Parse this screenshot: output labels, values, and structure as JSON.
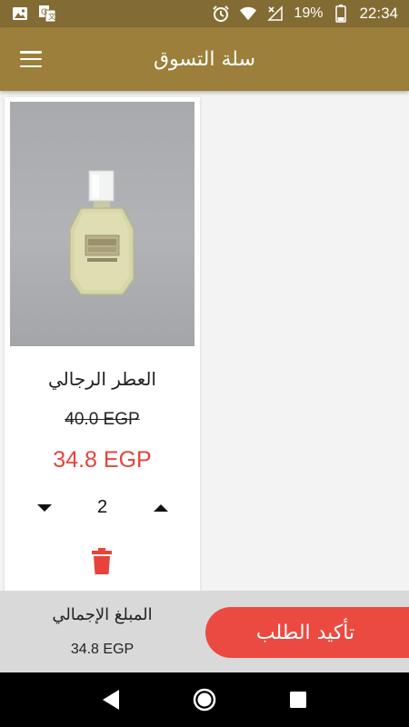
{
  "status_bar": {
    "battery_percent": "19%",
    "time": "22:34",
    "icons": [
      "image-icon",
      "translate-icon",
      "alarm-icon",
      "wifi-icon",
      "signal-icon",
      "battery-icon"
    ]
  },
  "header": {
    "title": "سلة التسوق",
    "menu_icon": "hamburger-menu-icon"
  },
  "cart": {
    "items": [
      {
        "name": "العطر الرجالي",
        "old_price": "40.0 EGP",
        "new_price": "34.8 EGP",
        "quantity": "2"
      }
    ]
  },
  "summary": {
    "total_label": "المبلغ الإجمالي",
    "total_value": "34.8 EGP",
    "confirm_label": "تأكيد الطلب"
  },
  "nav": {
    "icons": [
      "back-icon",
      "home-icon",
      "recents-icon"
    ]
  },
  "colors": {
    "status_bar": "#836c33",
    "app_bar": "#9b7f3a",
    "price_red": "#e8433a",
    "confirm_button": "#eb4a40",
    "summary_bg": "#d9d9d9"
  }
}
